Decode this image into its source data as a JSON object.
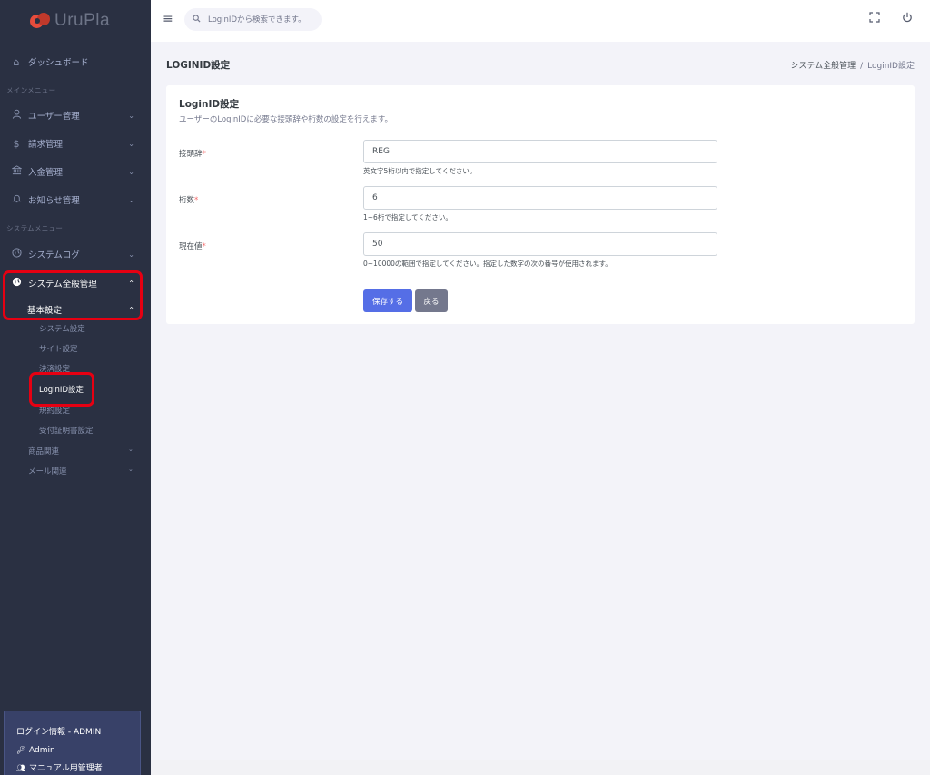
{
  "brand": {
    "name": "UruPla"
  },
  "topbar": {
    "search_placeholder": "LoginIDから検索できます。",
    "menu_icon": "hamburger-icon",
    "fullscreen_icon": "fullscreen-icon",
    "power_icon": "power-icon"
  },
  "sidebar": {
    "dashboard": "ダッシュボード",
    "main_menu_title": "メインメニュー",
    "users": "ユーザー管理",
    "billing": "請求管理",
    "payments": "入金管理",
    "notices": "お知らせ管理",
    "system_menu_title": "システムメニュー",
    "system_log": "システムログ",
    "system_general": "システム全般管理",
    "basic_settings": "基本設定",
    "sub_items": [
      "システム設定",
      "サイト設定",
      "決済設定",
      "LoginID設定",
      "規約設定",
      "受付証明書設定"
    ],
    "product": "商品関連",
    "mail": "メール関連",
    "login_info": {
      "title": "ログイン情報 - ADMIN",
      "user": "Admin",
      "role": "マニュアル用管理者"
    }
  },
  "page": {
    "title": "LOGINID設定",
    "breadcrumb": {
      "parent": "システム全般管理",
      "separator": "/",
      "current": "LoginID設定"
    }
  },
  "form": {
    "title": "LoginID設定",
    "description": "ユーザーのLoginIDに必要な接頭辞や桁数の設定を行えます。",
    "required_mark": "*",
    "fields": [
      {
        "label": "接頭辞",
        "value": "REG",
        "help": "英文字5桁以内で指定してください。"
      },
      {
        "label": "桁数",
        "value": "6",
        "help": "1~6桁で指定してください。"
      },
      {
        "label": "現在値",
        "value": "50",
        "help": "0~10000の範囲で指定してください。指定した数字の次の番号が使用されます。"
      }
    ],
    "save_label": "保存する",
    "back_label": "戻る"
  }
}
